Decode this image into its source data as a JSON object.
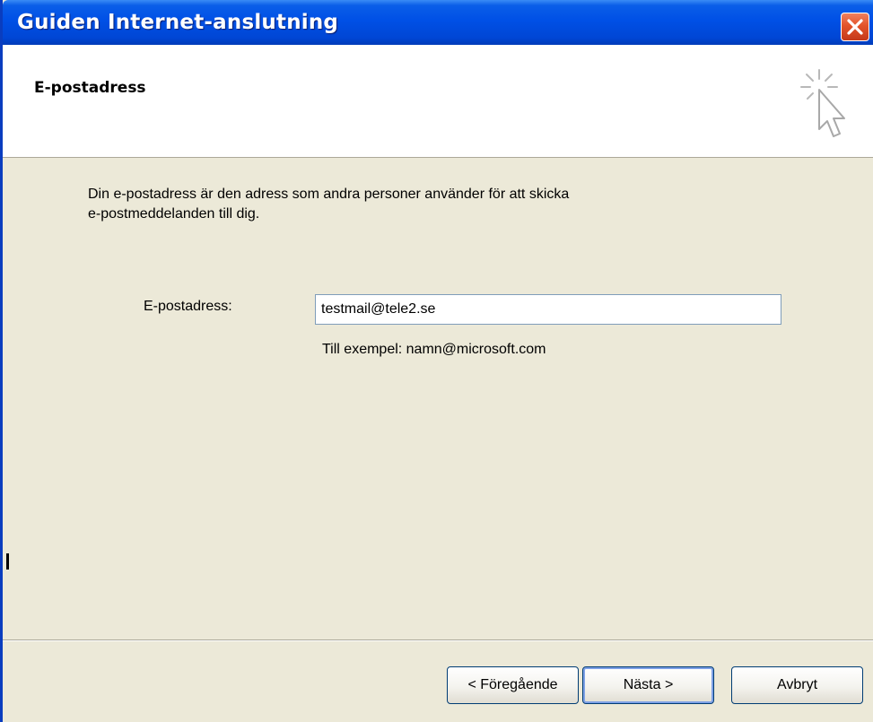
{
  "window": {
    "title": "Guiden Internet-anslutning"
  },
  "header": {
    "heading": "E-postadress",
    "icon": "wizard-cursor-icon"
  },
  "content": {
    "description_line1": "Din e-postadress är den adress som andra personer använder för att skicka",
    "description_line2": "e-postmeddelanden till dig.",
    "email_label": "E-postadress:",
    "email_value": "testmail@tele2.se",
    "example_text": "Till exempel: namn@microsoft.com"
  },
  "buttons": {
    "back_label": "< Föregående",
    "next_label": "Nästa >",
    "cancel_label": "Avbryt"
  },
  "colors": {
    "titlebar": "#0050e6",
    "dialog_bg": "#ece9d8",
    "close_button": "#e3542a"
  }
}
